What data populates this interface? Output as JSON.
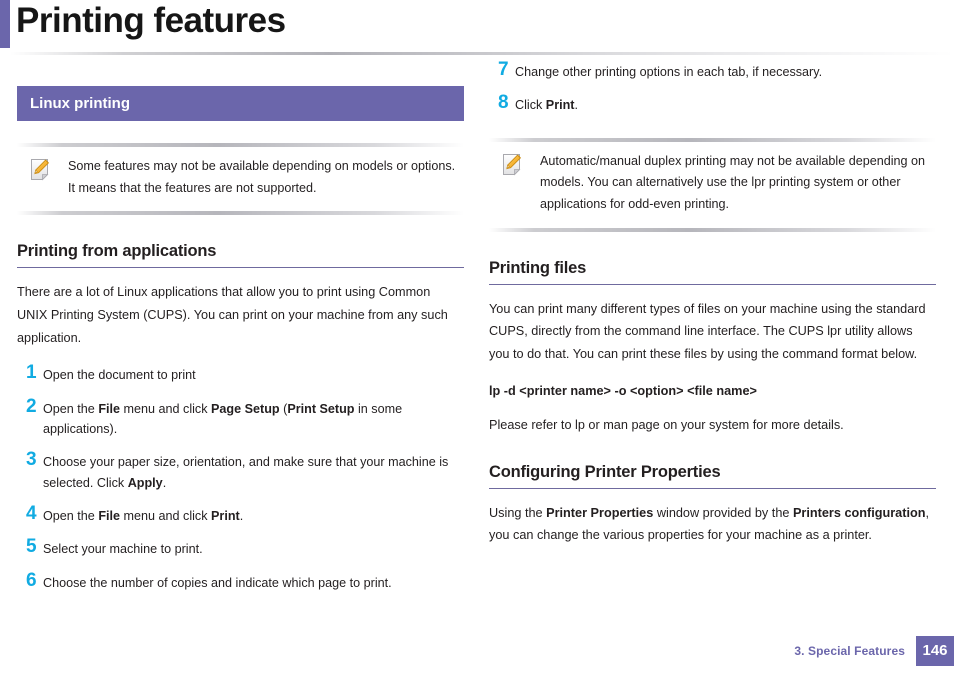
{
  "header": {
    "title": "Printing features",
    "accent_color": "#6b66ab"
  },
  "colors": {
    "banner_purple": "#6b66ab",
    "step_number_blue": "#11abe2",
    "heading_rule": "#6f6a9e",
    "body_text": "#231f20"
  },
  "left_column": {
    "banner": "Linux printing",
    "note": {
      "icon": "note-pencil-icon",
      "text": "Some features may not be available depending on models or options. It means that the features are not supported."
    },
    "section": {
      "heading": "Printing from applications",
      "intro": "There are a lot of Linux applications that allow you to print using Common UNIX Printing System (CUPS). You can print on your machine from any such application."
    },
    "steps": [
      {
        "num": "1",
        "html": "Open the document to print"
      },
      {
        "num": "2",
        "html": "Open the <b>File</b> menu and click <b>Page Setup</b> (<b>Print Setup</b> in some applications)."
      },
      {
        "num": "3",
        "html": "Choose your paper size, orientation, and make sure that your machine is selected. Click <b>Apply</b>."
      },
      {
        "num": "4",
        "html": "Open the <b>File</b> menu and click <b>Print</b>."
      },
      {
        "num": "5",
        "html": "Select your machine to print."
      },
      {
        "num": "6",
        "html": "Choose the number of copies and indicate which page to print."
      }
    ]
  },
  "right_column": {
    "steps": [
      {
        "num": "7",
        "html": "Change other printing options in each tab, if necessary."
      },
      {
        "num": "8",
        "html": "Click <b>Print</b>."
      }
    ],
    "note": {
      "icon": "note-pencil-icon",
      "text": "Automatic/manual duplex printing may not be available depending on models. You can alternatively use the lpr printing system or other applications for odd-even printing."
    },
    "printing_files": {
      "heading": "Printing files",
      "para": "You can print many different types of files on your machine using the standard CUPS, directly from the command line interface. The CUPS lpr utility allows you to do that. You can print these files by using the command format below.",
      "command": "lp -d <printer name> -o <option> <file name>",
      "footnote": "Please refer to lp or man page on your system for more details."
    },
    "configuring": {
      "heading": "Configuring Printer Properties",
      "para_html": "Using the <b>Printer Properties</b> window provided by the <b>Printers configuration</b>, you can change the various properties for your machine as a printer."
    }
  },
  "footer": {
    "chapter": "3.  Special Features",
    "page_number": "146"
  }
}
